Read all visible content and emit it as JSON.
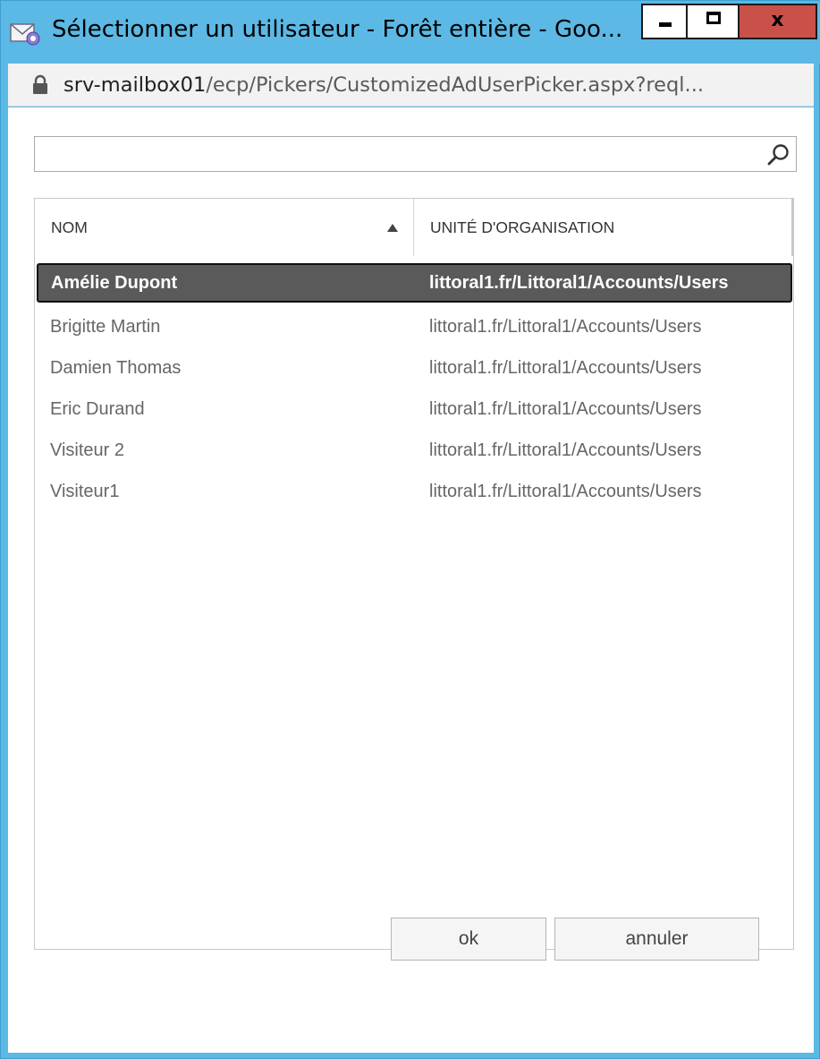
{
  "window": {
    "title": "Sélectionner un utilisateur - Forêt entière - Goo...",
    "minimize_label": "",
    "maximize_label": "",
    "close_label": "x"
  },
  "address": {
    "host": "srv-mailbox01",
    "path": "/ecp/Pickers/CustomizedAdUserPicker.aspx?reql..."
  },
  "search": {
    "value": "",
    "placeholder": ""
  },
  "grid": {
    "columns": [
      "NOM",
      "UNITÉ D'ORGANISATION"
    ],
    "sort": "ascending",
    "rows": [
      {
        "name": "Amélie Dupont",
        "ou": "littoral1.fr/Littoral1/Accounts/Users",
        "selected": true
      },
      {
        "name": "Brigitte Martin",
        "ou": "littoral1.fr/Littoral1/Accounts/Users",
        "selected": false
      },
      {
        "name": "Damien Thomas",
        "ou": "littoral1.fr/Littoral1/Accounts/Users",
        "selected": false
      },
      {
        "name": "Eric Durand",
        "ou": "littoral1.fr/Littoral1/Accounts/Users",
        "selected": false
      },
      {
        "name": "Visiteur 2",
        "ou": "littoral1.fr/Littoral1/Accounts/Users",
        "selected": false
      },
      {
        "name": "Visiteur1",
        "ou": "littoral1.fr/Littoral1/Accounts/Users",
        "selected": false
      }
    ]
  },
  "buttons": {
    "ok": "ok",
    "cancel": "annuler"
  },
  "colors": {
    "titlebar": "#5cb8e4",
    "close_button": "#c9514a",
    "selected_row": "#5a5a5a"
  },
  "icons": {
    "app": "mail-picker-icon",
    "lock": "lock-icon",
    "search": "search-icon",
    "sort": "sort-ascending-icon"
  }
}
